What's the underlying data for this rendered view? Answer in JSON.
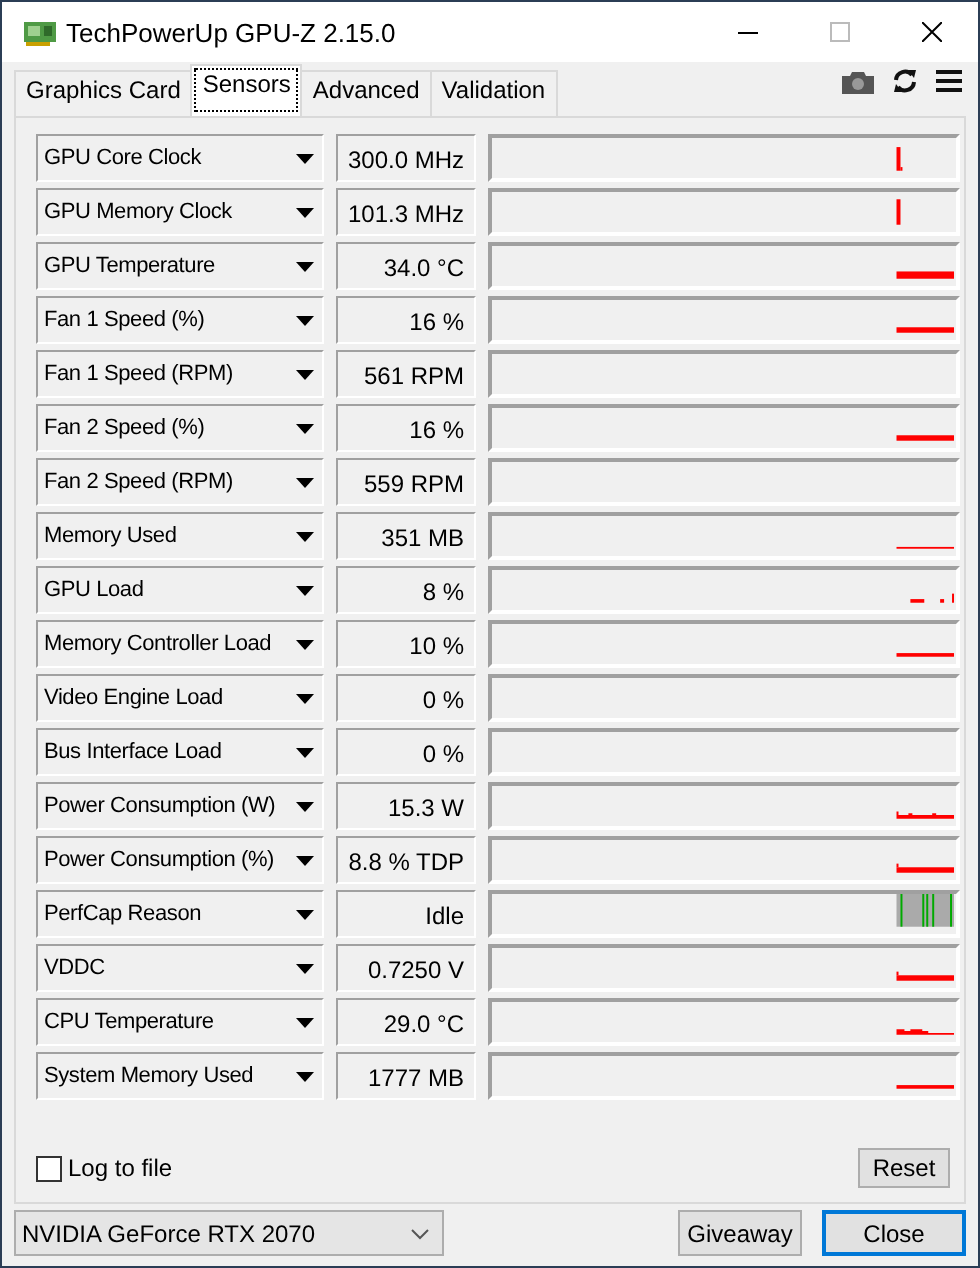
{
  "window": {
    "title": "TechPowerUp GPU-Z 2.15.0"
  },
  "tabs": [
    {
      "label": "Graphics Card",
      "selected": false
    },
    {
      "label": "Sensors",
      "selected": true
    },
    {
      "label": "Advanced",
      "selected": false
    },
    {
      "label": "Validation",
      "selected": false
    }
  ],
  "sensors": [
    {
      "name": "GPU Core Clock",
      "value": "300.0 MHz"
    },
    {
      "name": "GPU Memory Clock",
      "value": "101.3 MHz"
    },
    {
      "name": "GPU Temperature",
      "value": "34.0 °C"
    },
    {
      "name": "Fan 1 Speed (%)",
      "value": "16 %"
    },
    {
      "name": "Fan 1 Speed (RPM)",
      "value": "561 RPM"
    },
    {
      "name": "Fan 2 Speed (%)",
      "value": "16 %"
    },
    {
      "name": "Fan 2 Speed (RPM)",
      "value": "559 RPM"
    },
    {
      "name": "Memory Used",
      "value": "351 MB"
    },
    {
      "name": "GPU Load",
      "value": "8 %"
    },
    {
      "name": "Memory Controller Load",
      "value": "10 %"
    },
    {
      "name": "Video Engine Load",
      "value": "0 %"
    },
    {
      "name": "Bus Interface Load",
      "value": "0 %"
    },
    {
      "name": "Power Consumption (W)",
      "value": "15.3 W"
    },
    {
      "name": "Power Consumption (%)",
      "value": "8.8 % TDP"
    },
    {
      "name": "PerfCap Reason",
      "value": "Idle"
    },
    {
      "name": "VDDC",
      "value": "0.7250 V"
    },
    {
      "name": "CPU Temperature",
      "value": "29.0 °C"
    },
    {
      "name": "System Memory Used",
      "value": "1777 MB"
    }
  ],
  "log_to_file": {
    "label": "Log to file",
    "checked": false
  },
  "reset_button": "Reset",
  "gpu_select": {
    "value": "NVIDIA GeForce RTX 2070"
  },
  "buttons": [
    "Giveaway",
    "Close"
  ]
}
